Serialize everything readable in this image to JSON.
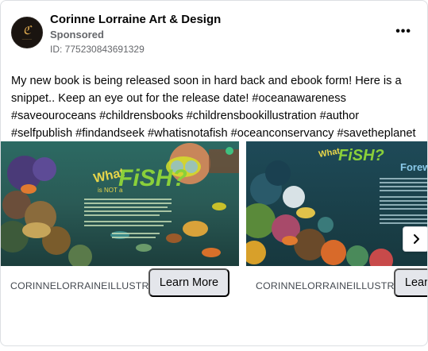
{
  "post": {
    "page_name": "Corinne Lorraine Art & Design",
    "sponsored_label": "Sponsored",
    "ad_id": "ID: 775230843691329",
    "text": "My new book is being released soon in hard back and ebook form! Here is a snippet.. Keep an eye out for the release date! #oceanawareness #saveouroceans #childrensbooks #childrensbookillustration #author #selfpublish #findandseek #whatisnotafish #oceanconservancy #savetheplanet #picturebook",
    "more_icon": "more-horizontal-icon"
  },
  "carousel": {
    "slides": [
      {
        "title_art": "What is NOT a FISH?",
        "domain": "CORINNELORRAINEILLUSTRATI",
        "cta": "Learn More"
      },
      {
        "title_art": "Foreward",
        "domain": "CORINNELORRAINEILLUSTRATI",
        "cta": "Learn More"
      }
    ],
    "next_icon": "chevron-right-icon"
  }
}
